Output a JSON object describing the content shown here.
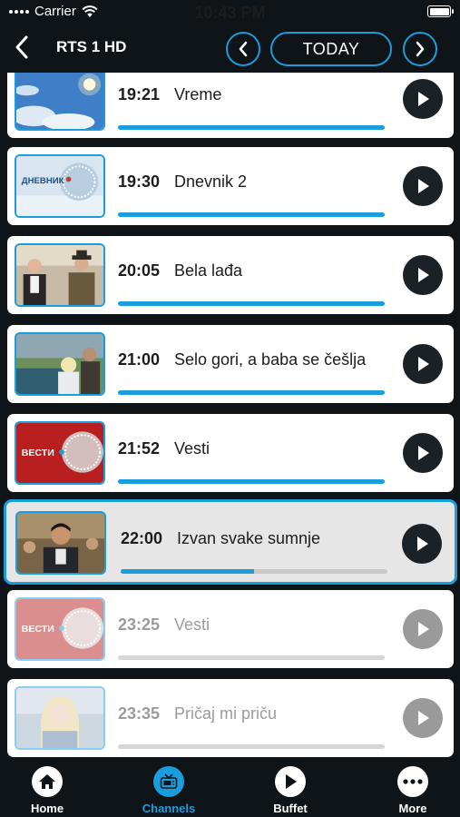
{
  "status": {
    "carrier": "Carrier",
    "time": "10:43 PM"
  },
  "nav": {
    "channel": "RTS 1 HD",
    "date_label": "TODAY"
  },
  "programs": [
    {
      "time": "19:21",
      "title": "Vreme",
      "progress": 1.0,
      "state": "past",
      "thumb": "sky"
    },
    {
      "time": "19:30",
      "title": "Dnevnik 2",
      "progress": 1.0,
      "state": "past",
      "thumb": "dnevnik",
      "thumb_text": "ДНЕВНИК"
    },
    {
      "time": "20:05",
      "title": "Bela lađa",
      "progress": 1.0,
      "state": "past",
      "thumb": "people"
    },
    {
      "time": "21:00",
      "title": "Selo gori, a baba se češlja",
      "progress": 1.0,
      "state": "past",
      "thumb": "outdoor"
    },
    {
      "time": "21:52",
      "title": "Vesti",
      "progress": 1.0,
      "state": "past",
      "thumb": "vesti",
      "thumb_text": "ВЕСТИ"
    },
    {
      "time": "22:00",
      "title": "Izvan svake sumnje",
      "progress": 0.5,
      "state": "active",
      "thumb": "man"
    },
    {
      "time": "23:25",
      "title": "Vesti",
      "progress": 0.0,
      "state": "future",
      "thumb": "vesti",
      "thumb_text": "ВЕСТИ"
    },
    {
      "time": "23:35",
      "title": "Pričaj mi priču",
      "progress": 0.0,
      "state": "future",
      "thumb": "woman"
    }
  ],
  "tabs": [
    {
      "label": "Home",
      "icon": "home-icon",
      "active": false
    },
    {
      "label": "Channels",
      "icon": "tv-icon",
      "active": true
    },
    {
      "label": "Buffet",
      "icon": "play-icon",
      "active": false
    },
    {
      "label": "More",
      "icon": "more-icon",
      "active": false
    }
  ],
  "colors": {
    "accent": "#1a9ddc",
    "background": "#0f1418",
    "play": "#1a2127"
  }
}
